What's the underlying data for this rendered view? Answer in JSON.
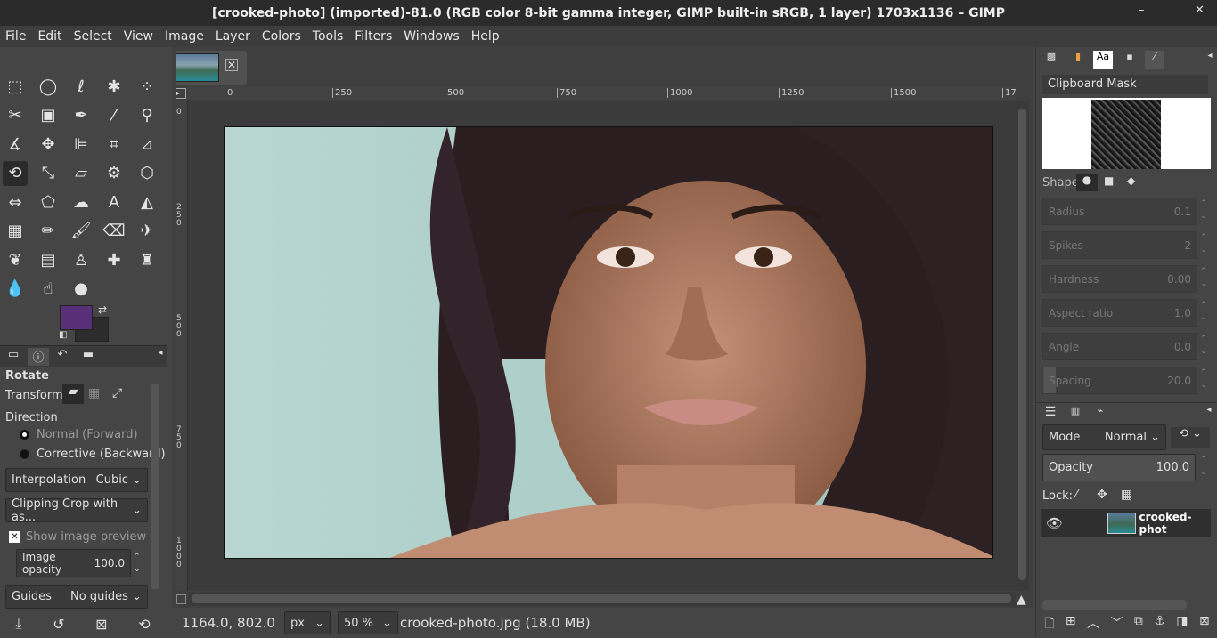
{
  "window": {
    "title": "[crooked-photo] (imported)-81.0 (RGB color 8-bit gamma integer, GIMP built-in sRGB, 1 layer) 1703x1136 – GIMP",
    "minimize": "–",
    "close": "✕"
  },
  "menu": [
    "File",
    "Edit",
    "Select",
    "View",
    "Image",
    "Layer",
    "Colors",
    "Tools",
    "Filters",
    "Windows",
    "Help"
  ],
  "toolbox": {
    "tools": [
      {
        "icon": "rect-select-icon",
        "glyph": "⬚"
      },
      {
        "icon": "ellipse-select-icon",
        "glyph": "◯"
      },
      {
        "icon": "free-select-icon",
        "glyph": "ℓ"
      },
      {
        "icon": "fuzzy-select-icon",
        "glyph": "✱"
      },
      {
        "icon": "select-by-color-icon",
        "glyph": "⁘"
      },
      {
        "icon": "scissors-icon",
        "glyph": "✂"
      },
      {
        "icon": "foreground-select-icon",
        "glyph": "▣"
      },
      {
        "icon": "paths-icon",
        "glyph": "✒"
      },
      {
        "icon": "color-picker-icon",
        "glyph": "⁄"
      },
      {
        "icon": "zoom-icon",
        "glyph": "⚲"
      },
      {
        "icon": "measure-icon",
        "glyph": "∡"
      },
      {
        "icon": "move-icon",
        "glyph": "✥"
      },
      {
        "icon": "align-icon",
        "glyph": "⊫"
      },
      {
        "icon": "crop-icon",
        "glyph": "⌗"
      },
      {
        "icon": "unified-transform-icon",
        "glyph": "⊿"
      },
      {
        "icon": "rotate-icon",
        "glyph": "⟲"
      },
      {
        "icon": "scale-icon",
        "glyph": "⤡"
      },
      {
        "icon": "shear-icon",
        "glyph": "▱"
      },
      {
        "icon": "handle-transform-icon",
        "glyph": "⚙"
      },
      {
        "icon": "3d-transform-icon",
        "glyph": "⬡"
      },
      {
        "icon": "warp-icon",
        "glyph": "⇔"
      },
      {
        "icon": "cage-icon",
        "glyph": "⬠"
      },
      {
        "icon": "smudge-icon",
        "glyph": "☁"
      },
      {
        "icon": "text-icon",
        "glyph": "A"
      },
      {
        "icon": "bucket-fill-icon",
        "glyph": "◭"
      },
      {
        "icon": "gradient-icon",
        "glyph": "▦"
      },
      {
        "icon": "pencil-icon",
        "glyph": "✏"
      },
      {
        "icon": "paintbrush-icon",
        "glyph": "🖌"
      },
      {
        "icon": "eraser-icon",
        "glyph": "⌫"
      },
      {
        "icon": "airbrush-icon",
        "glyph": "✈"
      },
      {
        "icon": "ink-icon",
        "glyph": "❦"
      },
      {
        "icon": "mypaint-icon",
        "glyph": "▤"
      },
      {
        "icon": "clone-icon",
        "glyph": "♙"
      },
      {
        "icon": "heal-icon",
        "glyph": "✚"
      },
      {
        "icon": "perspective-clone-icon",
        "glyph": "♜"
      },
      {
        "icon": "blur-icon",
        "glyph": "💧"
      },
      {
        "icon": "smudge-finger-icon",
        "glyph": "☝"
      },
      {
        "icon": "dodge-burn-icon",
        "glyph": "●"
      }
    ],
    "fg_color": "#5a2f7a",
    "bg_color": "#2c2c2c"
  },
  "tool_options": {
    "title": "Rotate",
    "transform_label": "Transform:",
    "direction_label": "Direction",
    "dir_normal": "Normal (Forward)",
    "dir_corrective": "Corrective (Backward)",
    "interpolation_label": "Interpolation",
    "interpolation_value": "Cubic",
    "clipping_value": "Clipping Crop with as...",
    "show_preview": "Show image preview",
    "image_opacity_label": "Image opacity",
    "image_opacity_value": "100.0",
    "guides_label": "Guides",
    "guides_value": "No guides"
  },
  "rulers": {
    "top": [
      "0",
      "250",
      "500",
      "750",
      "1000",
      "1250",
      "1500",
      "17"
    ],
    "left": [
      "0",
      "2 5 0",
      "5 0 0",
      "7 5 0",
      "1 0 0 0"
    ]
  },
  "status": {
    "coords": "1164.0, 802.0",
    "unit": "px",
    "zoom": "50 %",
    "file": "crooked-photo.jpg (18.0 MB)"
  },
  "brushes": {
    "header": "Clipboard Mask",
    "shape_label": "Shape:",
    "params": [
      {
        "label": "Radius",
        "value": "0.1"
      },
      {
        "label": "Spikes",
        "value": "2"
      },
      {
        "label": "Hardness",
        "value": "0.00"
      },
      {
        "label": "Aspect ratio",
        "value": "1.0"
      },
      {
        "label": "Angle",
        "value": "0.0"
      },
      {
        "label": "Spacing",
        "value": "20.0"
      }
    ]
  },
  "layers": {
    "mode_label": "Mode",
    "mode_value": "Normal",
    "opacity_label": "Opacity",
    "opacity_value": "100.0",
    "lock_label": "Lock:",
    "layer_name": "crooked-phot"
  }
}
